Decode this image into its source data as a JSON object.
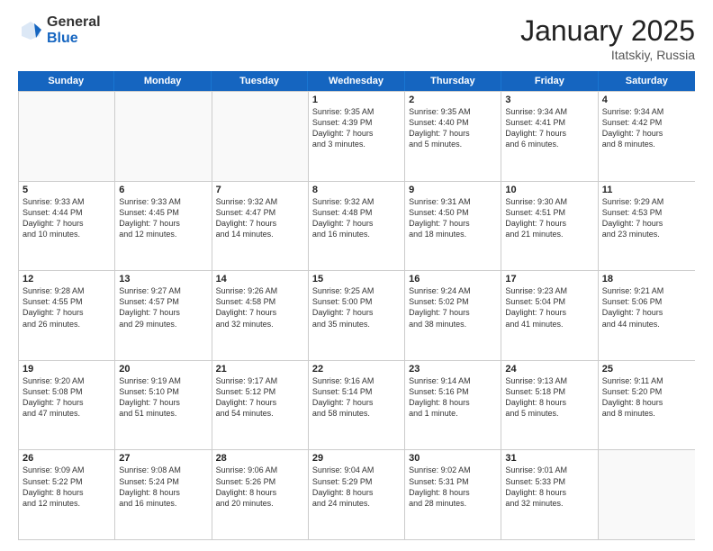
{
  "logo": {
    "general": "General",
    "blue": "Blue"
  },
  "title": "January 2025",
  "location": "Itatskiy, Russia",
  "header_days": [
    "Sunday",
    "Monday",
    "Tuesday",
    "Wednesday",
    "Thursday",
    "Friday",
    "Saturday"
  ],
  "rows": [
    [
      {
        "day": "",
        "text": "",
        "empty": true
      },
      {
        "day": "",
        "text": "",
        "empty": true
      },
      {
        "day": "",
        "text": "",
        "empty": true
      },
      {
        "day": "1",
        "text": "Sunrise: 9:35 AM\nSunset: 4:39 PM\nDaylight: 7 hours\nand 3 minutes."
      },
      {
        "day": "2",
        "text": "Sunrise: 9:35 AM\nSunset: 4:40 PM\nDaylight: 7 hours\nand 5 minutes."
      },
      {
        "day": "3",
        "text": "Sunrise: 9:34 AM\nSunset: 4:41 PM\nDaylight: 7 hours\nand 6 minutes."
      },
      {
        "day": "4",
        "text": "Sunrise: 9:34 AM\nSunset: 4:42 PM\nDaylight: 7 hours\nand 8 minutes."
      }
    ],
    [
      {
        "day": "5",
        "text": "Sunrise: 9:33 AM\nSunset: 4:44 PM\nDaylight: 7 hours\nand 10 minutes."
      },
      {
        "day": "6",
        "text": "Sunrise: 9:33 AM\nSunset: 4:45 PM\nDaylight: 7 hours\nand 12 minutes."
      },
      {
        "day": "7",
        "text": "Sunrise: 9:32 AM\nSunset: 4:47 PM\nDaylight: 7 hours\nand 14 minutes."
      },
      {
        "day": "8",
        "text": "Sunrise: 9:32 AM\nSunset: 4:48 PM\nDaylight: 7 hours\nand 16 minutes."
      },
      {
        "day": "9",
        "text": "Sunrise: 9:31 AM\nSunset: 4:50 PM\nDaylight: 7 hours\nand 18 minutes."
      },
      {
        "day": "10",
        "text": "Sunrise: 9:30 AM\nSunset: 4:51 PM\nDaylight: 7 hours\nand 21 minutes."
      },
      {
        "day": "11",
        "text": "Sunrise: 9:29 AM\nSunset: 4:53 PM\nDaylight: 7 hours\nand 23 minutes."
      }
    ],
    [
      {
        "day": "12",
        "text": "Sunrise: 9:28 AM\nSunset: 4:55 PM\nDaylight: 7 hours\nand 26 minutes."
      },
      {
        "day": "13",
        "text": "Sunrise: 9:27 AM\nSunset: 4:57 PM\nDaylight: 7 hours\nand 29 minutes."
      },
      {
        "day": "14",
        "text": "Sunrise: 9:26 AM\nSunset: 4:58 PM\nDaylight: 7 hours\nand 32 minutes."
      },
      {
        "day": "15",
        "text": "Sunrise: 9:25 AM\nSunset: 5:00 PM\nDaylight: 7 hours\nand 35 minutes."
      },
      {
        "day": "16",
        "text": "Sunrise: 9:24 AM\nSunset: 5:02 PM\nDaylight: 7 hours\nand 38 minutes."
      },
      {
        "day": "17",
        "text": "Sunrise: 9:23 AM\nSunset: 5:04 PM\nDaylight: 7 hours\nand 41 minutes."
      },
      {
        "day": "18",
        "text": "Sunrise: 9:21 AM\nSunset: 5:06 PM\nDaylight: 7 hours\nand 44 minutes."
      }
    ],
    [
      {
        "day": "19",
        "text": "Sunrise: 9:20 AM\nSunset: 5:08 PM\nDaylight: 7 hours\nand 47 minutes."
      },
      {
        "day": "20",
        "text": "Sunrise: 9:19 AM\nSunset: 5:10 PM\nDaylight: 7 hours\nand 51 minutes."
      },
      {
        "day": "21",
        "text": "Sunrise: 9:17 AM\nSunset: 5:12 PM\nDaylight: 7 hours\nand 54 minutes."
      },
      {
        "day": "22",
        "text": "Sunrise: 9:16 AM\nSunset: 5:14 PM\nDaylight: 7 hours\nand 58 minutes."
      },
      {
        "day": "23",
        "text": "Sunrise: 9:14 AM\nSunset: 5:16 PM\nDaylight: 8 hours\nand 1 minute."
      },
      {
        "day": "24",
        "text": "Sunrise: 9:13 AM\nSunset: 5:18 PM\nDaylight: 8 hours\nand 5 minutes."
      },
      {
        "day": "25",
        "text": "Sunrise: 9:11 AM\nSunset: 5:20 PM\nDaylight: 8 hours\nand 8 minutes."
      }
    ],
    [
      {
        "day": "26",
        "text": "Sunrise: 9:09 AM\nSunset: 5:22 PM\nDaylight: 8 hours\nand 12 minutes."
      },
      {
        "day": "27",
        "text": "Sunrise: 9:08 AM\nSunset: 5:24 PM\nDaylight: 8 hours\nand 16 minutes."
      },
      {
        "day": "28",
        "text": "Sunrise: 9:06 AM\nSunset: 5:26 PM\nDaylight: 8 hours\nand 20 minutes."
      },
      {
        "day": "29",
        "text": "Sunrise: 9:04 AM\nSunset: 5:29 PM\nDaylight: 8 hours\nand 24 minutes."
      },
      {
        "day": "30",
        "text": "Sunrise: 9:02 AM\nSunset: 5:31 PM\nDaylight: 8 hours\nand 28 minutes."
      },
      {
        "day": "31",
        "text": "Sunrise: 9:01 AM\nSunset: 5:33 PM\nDaylight: 8 hours\nand 32 minutes."
      },
      {
        "day": "",
        "text": "",
        "empty": true
      }
    ]
  ]
}
